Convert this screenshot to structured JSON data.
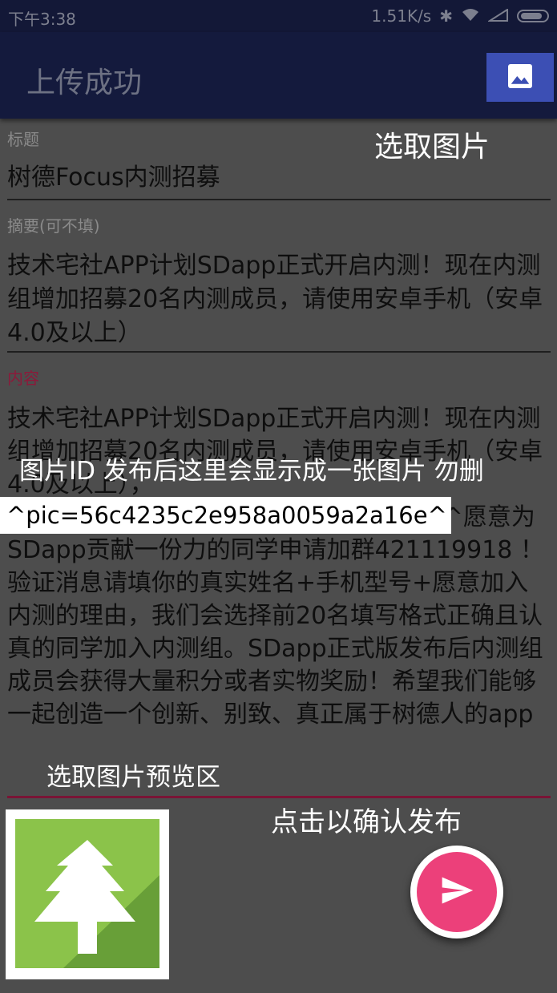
{
  "status_bar": {
    "time": "下午3:38",
    "speed": "1.51K/s"
  },
  "app_bar": {
    "title": "上传成功",
    "pick_image_icon": "image-icon"
  },
  "annotations": {
    "pick_image": "选取图片",
    "pic_id": "图片ID  发布后这里会显示成一张图片  勿删",
    "preview_area": "选取图片预览区",
    "confirm_publish": "点击以确认发布"
  },
  "form": {
    "title_label": "标题",
    "title_value": "树德Focus内测招募",
    "summary_label": "摘要(可不填)",
    "summary_value": "技术宅社APP计划SDapp正式开启内测！现在内测组增加招募20名内测成员，请使用安卓手机（安卓4.0及以上）",
    "content_label": "内容",
    "content_value": "技术宅社APP计划SDapp正式开启内测！现在内测组增加招募20名内测成员，请使用安卓手机（安卓4.0及以上），^pic=56c4235c2e958a0059a2a16e^愿意为SDapp贡献一份力的同学申请加群421119918 ！验证消息请填你的真实姓名+手机型号+愿意加入内测的理由，我们会选择前20名填写格式正确且认真的同学加入内测组。SDapp正式版发布后内测组成员会获得大量积分或者实物奖励！希望我们能够一起创造一个创新、别致、真正属于树德人的app",
    "pic_tag": "^pic=56c4235c2e958a0059a2a16e^"
  },
  "fab": {
    "icon": "send-icon"
  },
  "colors": {
    "appbar": "#141a3d",
    "pick_button": "#3c4fb4",
    "accent": "#ec407a",
    "content_label": "#8b1a3a",
    "content_divider": "#7a1436",
    "preview_green": "#8bc34a"
  }
}
